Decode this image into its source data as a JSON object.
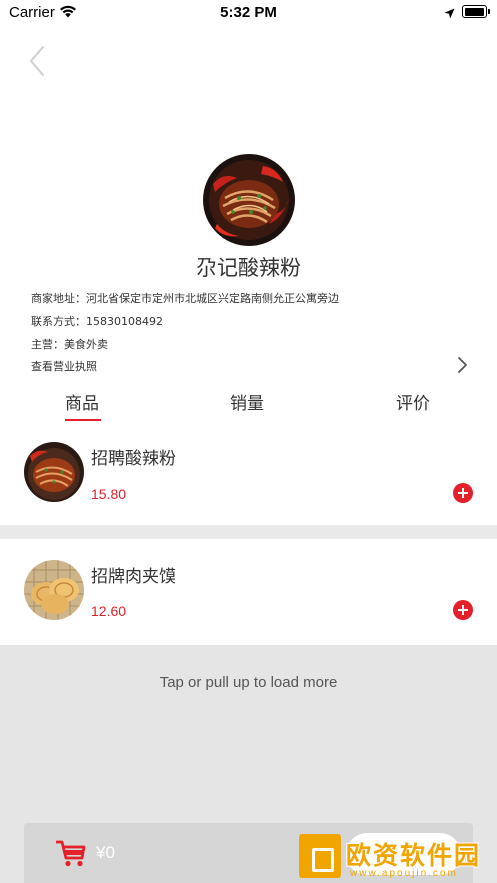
{
  "status_bar": {
    "carrier": "Carrier",
    "time": "5:32 PM",
    "battery_level": 0.9
  },
  "shop": {
    "name": "尕记酸辣粉",
    "address": "商家地址：河北省保定市定州市北城区兴定路南侧允正公寓旁边",
    "contact": "联系方式：15830108492",
    "category": "主营：美食外卖",
    "license": "查看营业执照"
  },
  "tabs": [
    {
      "label": "商品",
      "active": true
    },
    {
      "label": "销量",
      "active": false
    },
    {
      "label": "评价",
      "active": false
    }
  ],
  "products": [
    {
      "name": "招聘酸辣粉",
      "price": "15.80"
    },
    {
      "name": "招牌肉夹馍",
      "price": "12.60"
    }
  ],
  "load_more": "Tap or pull up to load more",
  "cart": {
    "total": "¥0"
  },
  "watermark": {
    "text": "欧资软件园",
    "url": "www.apoujin.com"
  },
  "colors": {
    "accent": "#e4202a",
    "watermark": "#f0a500"
  },
  "icons": [
    "back-chevron-icon",
    "chevron-right-icon",
    "add-icon",
    "cart-icon",
    "wifi-icon",
    "location-icon",
    "battery-icon"
  ]
}
